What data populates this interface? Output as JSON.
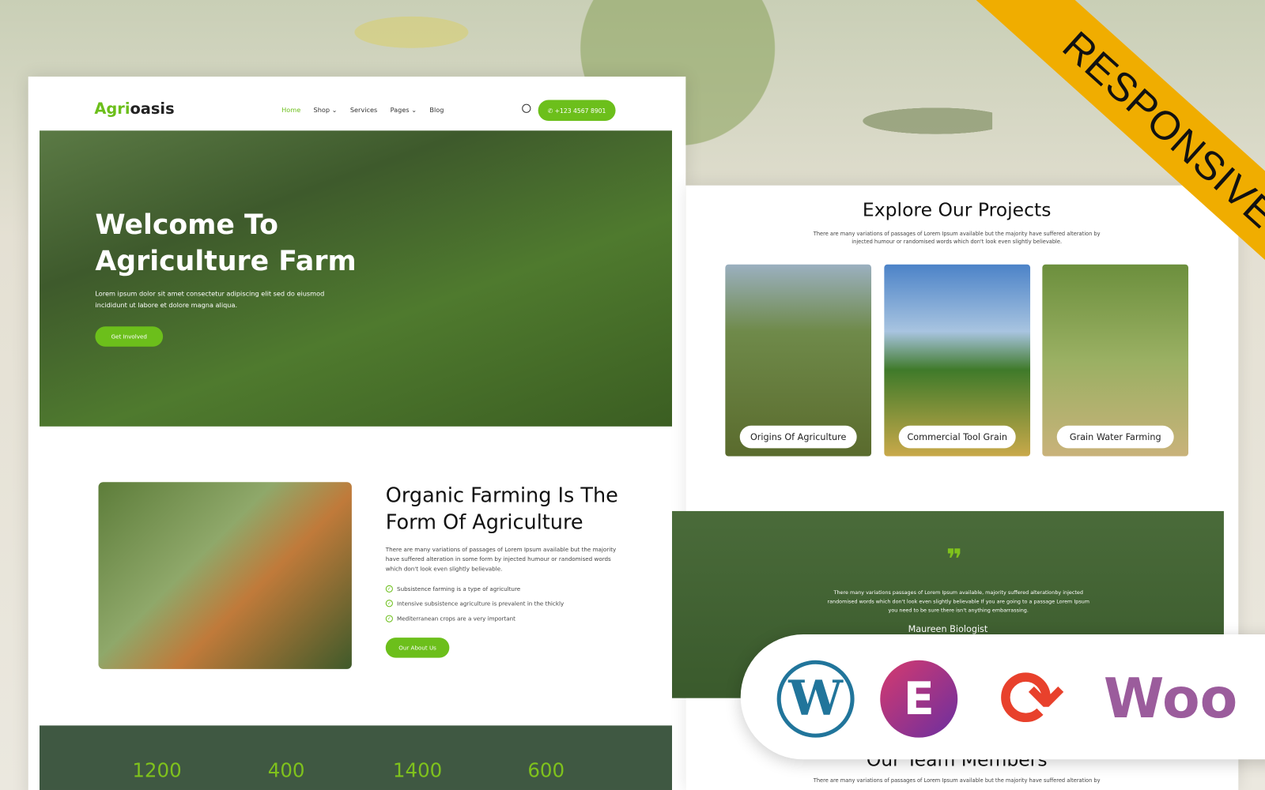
{
  "badge": "RESPONSIVE",
  "nav": {
    "logo_a": "Agri",
    "logo_b": "oasis",
    "items": [
      "Home",
      "Shop ⌄",
      "Services",
      "Pages ⌄",
      "Blog"
    ],
    "phone": "✆ +123 4567 8901"
  },
  "hero": {
    "title_1": "Welcome To",
    "title_2": "Agriculture Farm",
    "text": "Lorem ipsum dolor sit amet consectetur adipiscing elit sed do eiusmod incididunt ut labore et dolore magna aliqua.",
    "cta": "Get Involved"
  },
  "about": {
    "title": "Organic Farming Is The Form Of Agriculture",
    "text": "There are many variations of passages of Lorem Ipsum available but the majority have suffered alteration in some form by injected humour or randomised words which don't look even slightly believable.",
    "checks": [
      "Subsistence farming is a type of agriculture",
      "Intensive subsistence agriculture is prevalent in the thickly",
      "Mediterranean crops are a very important"
    ],
    "cta": "Our About Us"
  },
  "stats": [
    "1200",
    "400",
    "1400",
    "600"
  ],
  "projects": {
    "title": "Explore Our Projects",
    "text": "There are many variations of passages of Lorem Ipsum available but the majority have suffered alteration by injected humour or randomised words which don't look even slightly believable.",
    "cards": [
      "Origins Of Agriculture",
      "Commercial Tool Grain",
      "Grain Water Farming"
    ]
  },
  "testimonial": {
    "quote_mark": "❞",
    "text": "There many variations passages of Lorem Ipsum available, majority suffered alterationby injected randomised words which don't look even slightly believable If you are going to a passage Lorem Ipsum you need to be sure there isn't anything embarrassing.",
    "name": "Maureen Biologist"
  },
  "team": {
    "title": "Our Team Members",
    "text": "There are many variations of passages of Lorem Ipsum available but the majority have suffered alteration by"
  },
  "plugins": {
    "wordpress": "W",
    "elementor": "E",
    "update": "⟳",
    "woo": "Woo"
  },
  "colors": {
    "accent": "#6cbf1b",
    "ribbon": "#f0ad00",
    "dark_green": "#3f5842"
  }
}
